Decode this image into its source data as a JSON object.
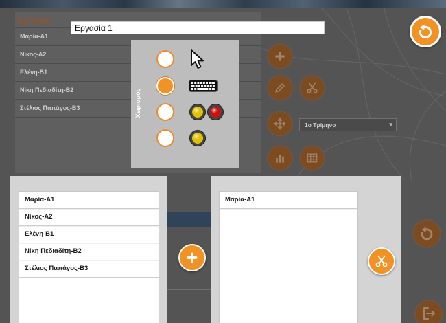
{
  "colors": {
    "accent": "#f39224",
    "accent_dim": "#9b5e28",
    "panel": "#d4d4d4",
    "dialog": "#bdbdbd",
    "switch_yellow": "#e2c100",
    "switch_red": "#cc1111"
  },
  "background": {
    "users_title": "Χρήστες",
    "users": [
      "Μαρία-Α1",
      "Νίκος-Α2",
      "Ελένη-Β1",
      "Νίκη Πεδιαδίτη-Β2",
      "Στέλιος Παπάγος-Β3"
    ],
    "toolbar": [
      {
        "icon": "plus-icon"
      },
      {
        "icon": "pencil-icon"
      },
      {
        "icon": "scissors-icon"
      },
      {
        "icon": "move-icon"
      },
      {
        "icon": "bar-chart-icon"
      },
      {
        "icon": "table-icon"
      }
    ],
    "period_select": {
      "selected": "1ο Τρίμηνο"
    },
    "side_buttons": [
      {
        "icon": "undo-icon"
      },
      {
        "icon": "exit-icon"
      }
    ]
  },
  "task_input": {
    "value": "Εργασία 1"
  },
  "top_right_button": {
    "icon": "undo-icon"
  },
  "input_mode_dialog": {
    "title": "Χειρισμός",
    "selected_index": 1,
    "options": [
      {
        "icon": "mouse-cursor-icon"
      },
      {
        "icon": "keyboard-icon"
      },
      {
        "icon": "two-switches-icon"
      },
      {
        "icon": "single-switch-icon"
      }
    ]
  },
  "available_users": {
    "items": [
      "Μαρία-Α1",
      "Νίκος-Α2",
      "Ελένη-Β1",
      "Νίκη Πεδιαδίτη-Β2",
      "Στέλιος Παπάγος-Β3"
    ],
    "action_icon": "plus-icon"
  },
  "assigned_users": {
    "items": [
      "Μαρία-Α1"
    ],
    "action_icon": "scissors-icon"
  }
}
